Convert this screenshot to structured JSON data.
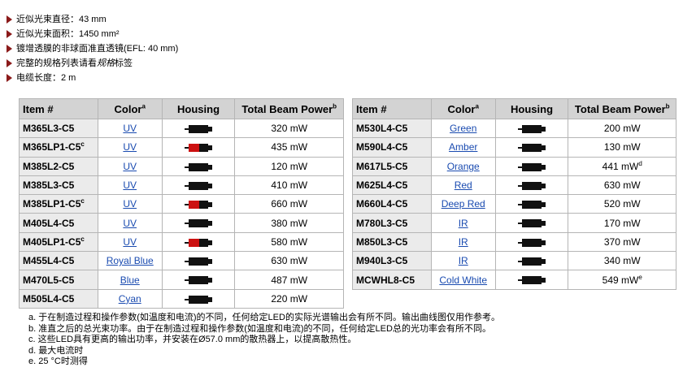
{
  "features": [
    {
      "text": "近似光束直径：43 mm"
    },
    {
      "text": "近似光束面积：1450 mm²"
    },
    {
      "text": "镀增透膜的非球面准直透镜(EFL: 40 mm)"
    },
    {
      "prefix": "完整的规格列表请看",
      "emph": "规格",
      "suffix": "标签"
    },
    {
      "text": "电缆长度：2 m"
    }
  ],
  "headers": {
    "item": "Item #",
    "color": "Color",
    "color_sup": "a",
    "housing": "Housing",
    "power": "Total Beam Power",
    "power_sup": "b"
  },
  "table_left": [
    {
      "item": "M365L3-C5",
      "item_sup": "",
      "color": "UV",
      "power": "320 mW",
      "power_sup": "",
      "housing_color": "#111111"
    },
    {
      "item": "M365LP1-C5",
      "item_sup": "c",
      "color": "UV",
      "power": "435 mW",
      "power_sup": "",
      "housing_color": "#cc1111"
    },
    {
      "item": "M385L2-C5",
      "item_sup": "",
      "color": "UV",
      "power": "120 mW",
      "power_sup": "",
      "housing_color": "#111111"
    },
    {
      "item": "M385L3-C5",
      "item_sup": "",
      "color": "UV",
      "power": "410 mW",
      "power_sup": "",
      "housing_color": "#111111"
    },
    {
      "item": "M385LP1-C5",
      "item_sup": "c",
      "color": "UV",
      "power": "660 mW",
      "power_sup": "",
      "housing_color": "#cc1111"
    },
    {
      "item": "M405L4-C5",
      "item_sup": "",
      "color": "UV",
      "power": "380 mW",
      "power_sup": "",
      "housing_color": "#111111"
    },
    {
      "item": "M405LP1-C5",
      "item_sup": "c",
      "color": "UV",
      "power": "580 mW",
      "power_sup": "",
      "housing_color": "#cc1111"
    },
    {
      "item": "M455L4-C5",
      "item_sup": "",
      "color": "Royal Blue",
      "power": "630 mW",
      "power_sup": "",
      "housing_color": "#111111"
    },
    {
      "item": "M470L5-C5",
      "item_sup": "",
      "color": "Blue",
      "power": "487 mW",
      "power_sup": "",
      "housing_color": "#111111"
    },
    {
      "item": "M505L4-C5",
      "item_sup": "",
      "color": "Cyan",
      "power": "220 mW",
      "power_sup": "",
      "housing_color": "#111111"
    }
  ],
  "table_right": [
    {
      "item": "M530L4-C5",
      "item_sup": "",
      "color": "Green",
      "power": "200 mW",
      "power_sup": "",
      "housing_color": "#111111"
    },
    {
      "item": "M590L4-C5",
      "item_sup": "",
      "color": "Amber",
      "power": "130 mW",
      "power_sup": "",
      "housing_color": "#111111"
    },
    {
      "item": "M617L5-C5",
      "item_sup": "",
      "color": "Orange",
      "power": "441 mW",
      "power_sup": "d",
      "housing_color": "#111111"
    },
    {
      "item": "M625L4-C5",
      "item_sup": "",
      "color": "Red",
      "power": "630 mW",
      "power_sup": "",
      "housing_color": "#111111"
    },
    {
      "item": "M660L4-C5",
      "item_sup": "",
      "color": "Deep Red",
      "power": "520 mW",
      "power_sup": "",
      "housing_color": "#111111"
    },
    {
      "item": "M780L3-C5",
      "item_sup": "",
      "color": "IR",
      "power": "170 mW",
      "power_sup": "",
      "housing_color": "#111111"
    },
    {
      "item": "M850L3-C5",
      "item_sup": "",
      "color": "IR",
      "power": "370 mW",
      "power_sup": "",
      "housing_color": "#111111"
    },
    {
      "item": "M940L3-C5",
      "item_sup": "",
      "color": "IR",
      "power": "340 mW",
      "power_sup": "",
      "housing_color": "#111111"
    },
    {
      "item": "MCWHL8-C5",
      "item_sup": "",
      "color": "Cold White",
      "power": "549 mW",
      "power_sup": "e",
      "housing_color": "#111111"
    }
  ],
  "footnotes": [
    "a. 于在制造过程和操作参数(如温度和电流)的不同，任何给定LED的实际光谱输出会有所不同。输出曲线图仅用作参考。",
    "b. 准直之后的总光束功率。由于在制造过程和操作参数(如温度和电流)的不同，任何给定LED总的光功率会有所不同。",
    "c. 这些LED具有更高的输出功率，并安装在Ø57.0 mm的散热器上，以提高散热性。",
    "d. 最大电流时",
    "e. 25 °C时测得"
  ],
  "colors": {
    "link": "#1a4bb0",
    "header_bg": "#d3d3d3",
    "item_bg": "#ebebeb",
    "bullet_arrow": "#8b1a1a",
    "led_red": "#cc1111"
  },
  "icons": {
    "bullet": "triangle-right-icon",
    "housing": "led-housing-icon"
  }
}
